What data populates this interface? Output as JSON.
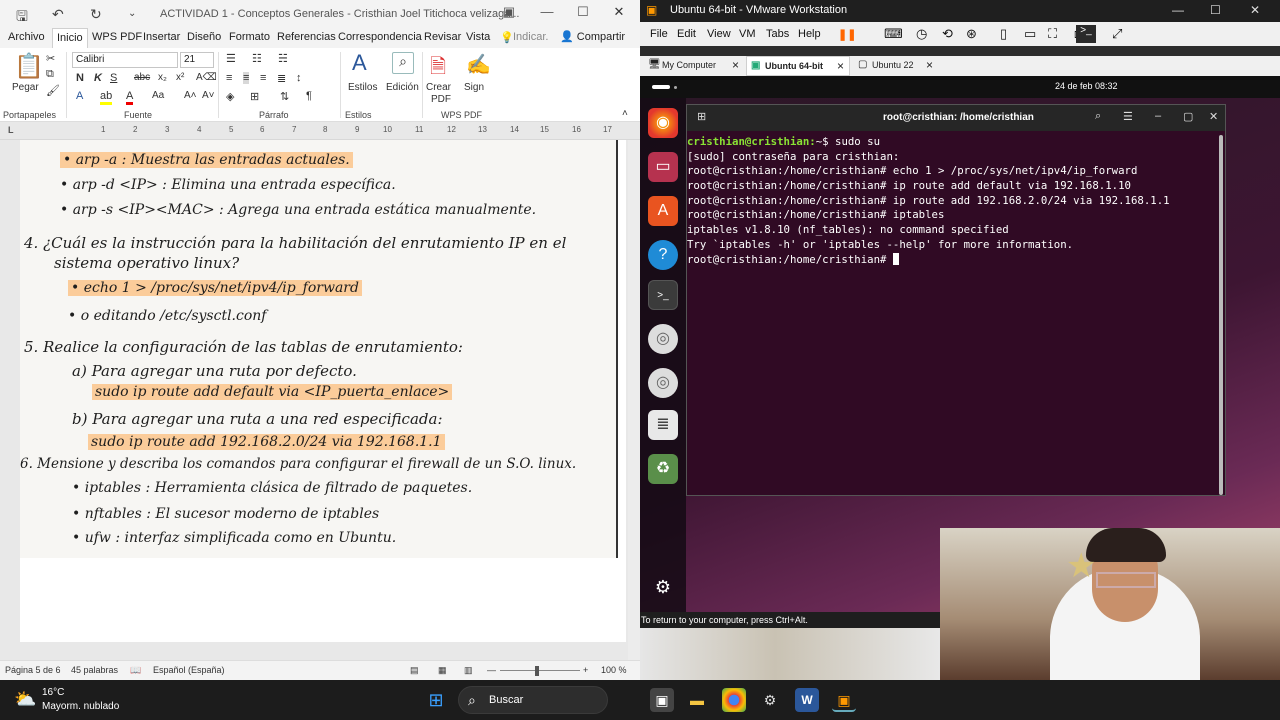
{
  "word": {
    "title": "ACTIVIDAD 1 - Conceptos Generales - Cristhian Joel Titichoca velizaga...",
    "menu": [
      "Archivo",
      "Inicio",
      "WPS PDF",
      "Insertar",
      "Diseño",
      "Formato",
      "Referencias",
      "Correspondencia",
      "Revisar",
      "Vista"
    ],
    "indicar": "Indicar.",
    "share": "Compartir",
    "ribbon": {
      "paste": "Pegar",
      "font_name": "Calibri",
      "font_size": "21",
      "styles": "Estilos",
      "editing": "Edición",
      "create_pdf_1": "Crear",
      "create_pdf_2": "PDF",
      "sign": "Sign",
      "groups": [
        "Portapapeles",
        "Fuente",
        "Párrafo",
        "Estilos",
        "WPS PDF"
      ]
    },
    "ruler_ticks": [
      "L",
      "1",
      "2",
      "3",
      "4",
      "5",
      "6",
      "7",
      "8",
      "9",
      "10",
      "11",
      "12",
      "13",
      "14",
      "15",
      "16",
      "17"
    ],
    "notes": [
      "• arp -a : Muestra las entradas actuales.",
      "• arp -d <IP> : Elimina una entrada específica.",
      "• arp -s <IP><MAC> : Agrega una entrada estática manualmente.",
      "4. ¿Cuál es la instrucción para la habilitación del enrutamiento IP en el",
      "sistema operativo linux?",
      "• echo 1 > /proc/sys/net/ipv4/ip_forward",
      "• o editando /etc/sysctl.conf",
      "5. Realice la configuración de las tablas de enrutamiento:",
      "a) Para agregar una ruta por defecto.",
      "sudo ip route add default via <IP_puerta_enlace>",
      "b) Para agregar una ruta a una red especificada:",
      "sudo ip route add 192.168.2.0/24 via 192.168.1.1",
      "6. Mensione y describa los comandos para configurar el firewall de un S.O. linux.",
      "• iptables : Herramienta clásica de filtrado de paquetes.",
      "• nftables : El sucesor moderno de iptables",
      "• ufw : interfaz simplificada como en Ubuntu."
    ],
    "status": {
      "page": "Página 5 de 6",
      "words": "45 palabras",
      "language": "Español (España)",
      "zoom": "100 %"
    }
  },
  "vmware": {
    "title": "Ubuntu 64-bit - VMware Workstation",
    "menu": [
      "File",
      "Edit",
      "View",
      "VM",
      "Tabs",
      "Help"
    ],
    "tabs": [
      "My Computer",
      "Ubuntu 64-bit",
      "Ubuntu 22"
    ],
    "date": "24 de feb  08:32",
    "terminal_title": "root@cristhian: /home/cristhian",
    "terminal_lines": [
      {
        "prompt": "cristhian@cristhian:",
        "text": "~$ sudo su"
      },
      {
        "prompt": "",
        "text": "[sudo] contraseña para cristhian:"
      },
      {
        "prompt": "",
        "text": "root@cristhian:/home/cristhian# echo 1 > /proc/sys/net/ipv4/ip_forward"
      },
      {
        "prompt": "",
        "text": "root@cristhian:/home/cristhian# ip route add default via 192.168.1.10"
      },
      {
        "prompt": "",
        "text": "root@cristhian:/home/cristhian# ip route add 192.168.2.0/24 via 192.168.1.1"
      },
      {
        "prompt": "",
        "text": "root@cristhian:/home/cristhian# iptables"
      },
      {
        "prompt": "",
        "text": "iptables v1.8.10 (nf_tables): no command specified"
      },
      {
        "prompt": "",
        "text": "Try `iptables -h' or 'iptables --help' for more information."
      },
      {
        "prompt": "",
        "text": "root@cristhian:/home/cristhian# "
      }
    ],
    "hint": "To return to your computer, press Ctrl+Alt."
  },
  "taskbar": {
    "temp": "16°C",
    "weather": "Mayorm. nublado",
    "search": "Buscar"
  },
  "colors": {
    "word_accent": "#2b579a",
    "terminal_bg": "#300a24",
    "prompt_green": "#8ae234",
    "highlight": "#ffaa50"
  }
}
